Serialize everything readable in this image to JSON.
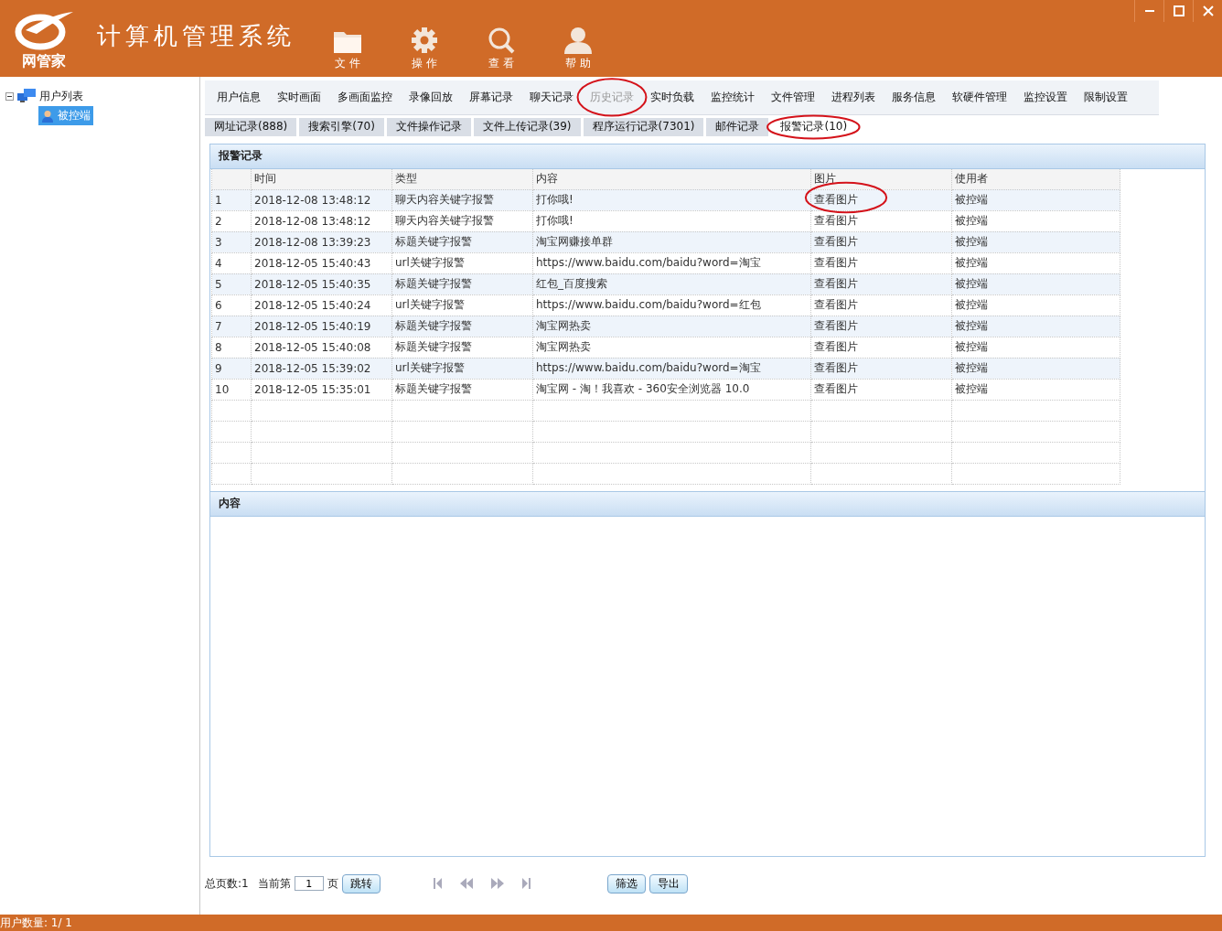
{
  "app": {
    "logo_text": "网管家",
    "title": "计算机管理系统"
  },
  "toolbar": [
    {
      "kind": "folder",
      "label": "文 件"
    },
    {
      "kind": "gear",
      "label": "操 作"
    },
    {
      "kind": "search",
      "label": "查 看"
    },
    {
      "kind": "person",
      "label": "帮 助"
    }
  ],
  "window_controls": [
    {
      "kind": "minimize"
    },
    {
      "kind": "maximize"
    },
    {
      "kind": "close"
    }
  ],
  "tree": {
    "label": "用户列表",
    "expanded": true,
    "children": [
      {
        "label": "被控端",
        "selected": true
      }
    ]
  },
  "nav_tabs": [
    {
      "label": "用户信息",
      "selected": false,
      "circled": false
    },
    {
      "label": "实时画面",
      "selected": false,
      "circled": false
    },
    {
      "label": "多画面监控",
      "selected": false,
      "circled": false
    },
    {
      "label": "录像回放",
      "selected": false,
      "circled": false
    },
    {
      "label": "屏幕记录",
      "selected": false,
      "circled": false
    },
    {
      "label": "聊天记录",
      "selected": false,
      "circled": false
    },
    {
      "label": "历史记录",
      "selected": true,
      "circled": true
    },
    {
      "label": "实时负载",
      "selected": false,
      "circled": false
    },
    {
      "label": "监控统计",
      "selected": false,
      "circled": false
    },
    {
      "label": "文件管理",
      "selected": false,
      "circled": false
    },
    {
      "label": "进程列表",
      "selected": false,
      "circled": false
    },
    {
      "label": "服务信息",
      "selected": false,
      "circled": false
    },
    {
      "label": "软硬件管理",
      "selected": false,
      "circled": false
    },
    {
      "label": "监控设置",
      "selected": false,
      "circled": false
    },
    {
      "label": "限制设置",
      "selected": false,
      "circled": false
    }
  ],
  "sub_tabs": [
    {
      "label": "网址记录(888)",
      "selected": false,
      "circled": false
    },
    {
      "label": "搜索引擎(70)",
      "selected": false,
      "circled": false
    },
    {
      "label": "文件操作记录",
      "selected": false,
      "circled": false
    },
    {
      "label": "文件上传记录(39)",
      "selected": false,
      "circled": false
    },
    {
      "label": "程序运行记录(7301)",
      "selected": false,
      "circled": false
    },
    {
      "label": "邮件记录",
      "selected": false,
      "circled": false
    },
    {
      "label": "报警记录(10)",
      "selected": true,
      "circled": true
    }
  ],
  "grid": {
    "title": "报警记录",
    "columns": [
      "时间",
      "类型",
      "内容",
      "图片",
      "使用者"
    ],
    "rows": [
      {
        "index": "1",
        "cells": [
          "2018-12-08 13:48:12",
          "聊天内容关键字报警",
          "打你哦!",
          "查看图片",
          "被控端"
        ],
        "circled": true
      },
      {
        "index": "2",
        "cells": [
          "2018-12-08 13:48:12",
          "聊天内容关键字报警",
          "打你哦!",
          "查看图片",
          "被控端"
        ],
        "circled": false
      },
      {
        "index": "3",
        "cells": [
          "2018-12-08 13:39:23",
          "标题关键字报警",
          "淘宝网赚接单群",
          "查看图片",
          "被控端"
        ],
        "circled": false
      },
      {
        "index": "4",
        "cells": [
          "2018-12-05 15:40:43",
          "url关键字报警",
          "https://www.baidu.com/baidu?word=淘宝",
          "查看图片",
          "被控端"
        ],
        "circled": false
      },
      {
        "index": "5",
        "cells": [
          "2018-12-05 15:40:35",
          "标题关键字报警",
          "红包_百度搜索",
          "查看图片",
          "被控端"
        ],
        "circled": false
      },
      {
        "index": "6",
        "cells": [
          "2018-12-05 15:40:24",
          "url关键字报警",
          "https://www.baidu.com/baidu?word=红包",
          "查看图片",
          "被控端"
        ],
        "circled": false
      },
      {
        "index": "7",
        "cells": [
          "2018-12-05 15:40:19",
          "标题关键字报警",
          "淘宝网热卖",
          "查看图片",
          "被控端"
        ],
        "circled": false
      },
      {
        "index": "8",
        "cells": [
          "2018-12-05 15:40:08",
          "标题关键字报警",
          "淘宝网热卖",
          "查看图片",
          "被控端"
        ],
        "circled": false
      },
      {
        "index": "9",
        "cells": [
          "2018-12-05 15:39:02",
          "url关键字报警",
          "https://www.baidu.com/baidu?word=淘宝",
          "查看图片",
          "被控端"
        ],
        "circled": false
      },
      {
        "index": "10",
        "cells": [
          "2018-12-05 15:35:01",
          "标题关键字报警",
          "淘宝网 - 淘！我喜欢 - 360安全浏览器 10.0",
          "查看图片",
          "被控端"
        ],
        "circled": false
      }
    ]
  },
  "content_panel": {
    "title": "内容"
  },
  "pager": {
    "total_label": "总页数:1",
    "current_label": "当前第",
    "page": "1",
    "page_suffix": "页",
    "jump": "跳转",
    "nav": [
      {
        "kind": "first"
      },
      {
        "kind": "prev"
      },
      {
        "kind": "next"
      },
      {
        "kind": "last"
      }
    ],
    "actions": [
      "筛选",
      "导出"
    ]
  },
  "status_bar": {
    "text": "用户数量: 1/ 1"
  }
}
